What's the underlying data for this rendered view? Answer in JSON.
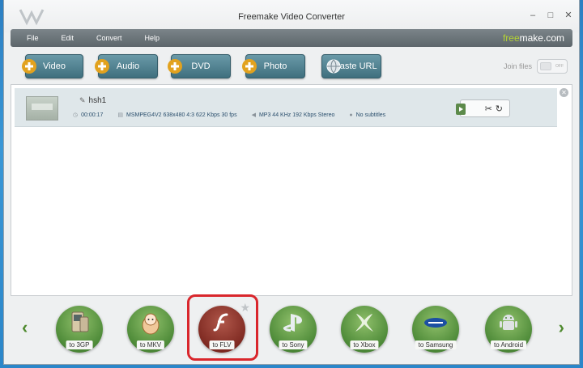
{
  "window": {
    "title": "Freemake Video Converter"
  },
  "menu": {
    "items": [
      "File",
      "Edit",
      "Convert",
      "Help"
    ],
    "brand_a": "free",
    "brand_b": "make.com"
  },
  "toolbar": {
    "buttons": [
      "Video",
      "Audio",
      "DVD",
      "Photo",
      "Paste URL"
    ],
    "join_label": "Join files",
    "toggle_text": "OFF"
  },
  "file": {
    "name": "hsh1",
    "duration": "00:00:17",
    "video": "MSMPEG4V2  638x480  4:3  622 Kbps  30 fps",
    "audio": "MP3  44 KHz  192 Kbps  Stereo",
    "subtitles": "No subtitles"
  },
  "formats": [
    "to 3GP",
    "to MKV",
    "to FLV",
    "to Sony",
    "to Xbox",
    "to Samsung",
    "to Android"
  ],
  "colors": {
    "accent": "#4d8a38",
    "highlight": "#d9262c",
    "menubar": "#5d666b"
  }
}
